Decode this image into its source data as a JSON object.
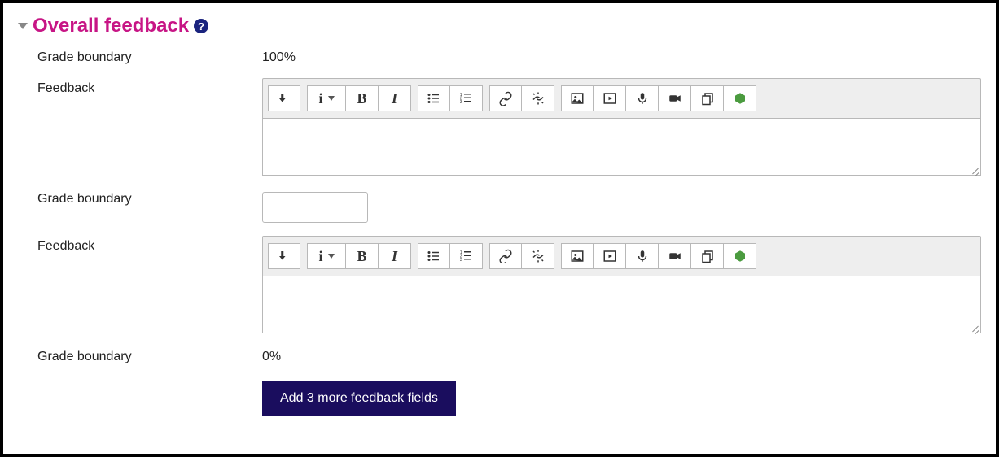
{
  "section": {
    "title": "Overall feedback"
  },
  "rows": {
    "boundary1": {
      "label": "Grade boundary",
      "value": "100%"
    },
    "feedback1": {
      "label": "Feedback"
    },
    "boundary2": {
      "label": "Grade boundary",
      "value": ""
    },
    "feedback2": {
      "label": "Feedback"
    },
    "boundary3": {
      "label": "Grade boundary",
      "value": "0%"
    }
  },
  "toolbar": {
    "bold_glyph": "B",
    "italic_glyph": "I",
    "info_glyph": "i"
  },
  "button": {
    "add_label": "Add 3 more feedback fields"
  }
}
